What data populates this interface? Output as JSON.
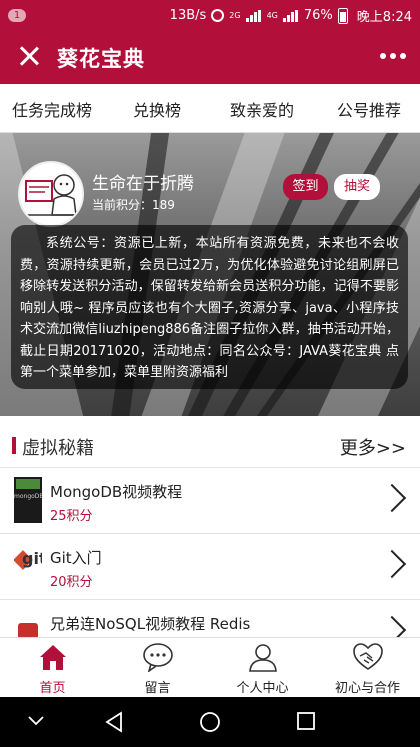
{
  "status_bar": {
    "notification_count": "1",
    "speed": "13B/s",
    "network_1": "2G",
    "network_2": "4G",
    "battery": "76%",
    "time": "晚上8:24"
  },
  "title_bar": {
    "title": "葵花宝典",
    "close_icon": "close-icon",
    "more_icon": "more-dots-icon"
  },
  "nav_tabs": [
    "任务完成榜",
    "兑换榜",
    "致亲爱的",
    "公号推荐"
  ],
  "profile": {
    "username": "生命在于折腾",
    "points_label": "当前积分：",
    "points_value": "189",
    "signin_label": "签到",
    "lottery_label": "抽奖"
  },
  "notice": "系统公号：资源已上新，本站所有资源免费，未来也不会收费，资源持续更新，会员已过2万，为优化体验避免讨论组刷屏已移除转发送积分活动，保留转发给新会员送积分功能，记得不要影响别人哦~ 程序员应该也有个大圈子,资源分享、java、小程序技术交流加微信liuzhipeng886备注圈子拉你入群，抽书活动开始，截止日期20171020，活动地点：同名公众号：JAVA葵花宝典 点第一个菜单参加，菜单里附资源福利",
  "section": {
    "title": "虚拟秘籍",
    "more_label": "更多>>"
  },
  "items": [
    {
      "name": "MongoDB视频教程",
      "points": "25积分",
      "thumb_text": "mongoDB"
    },
    {
      "name": "Git入门",
      "points": "20积分",
      "thumb_text": "git"
    },
    {
      "name": "兄弟连NoSQL视频教程 Redis",
      "points": "",
      "thumb_text": ""
    }
  ],
  "tab_bar": [
    {
      "label": "首页",
      "icon": "home-icon",
      "active": true
    },
    {
      "label": "留言",
      "icon": "chat-bubble-icon",
      "active": false
    },
    {
      "label": "个人中心",
      "icon": "person-icon",
      "active": false
    },
    {
      "label": "初心与合作",
      "icon": "handshake-icon",
      "active": false
    }
  ],
  "colors": {
    "primary": "#b2103a",
    "points_text": "#b2103a"
  }
}
